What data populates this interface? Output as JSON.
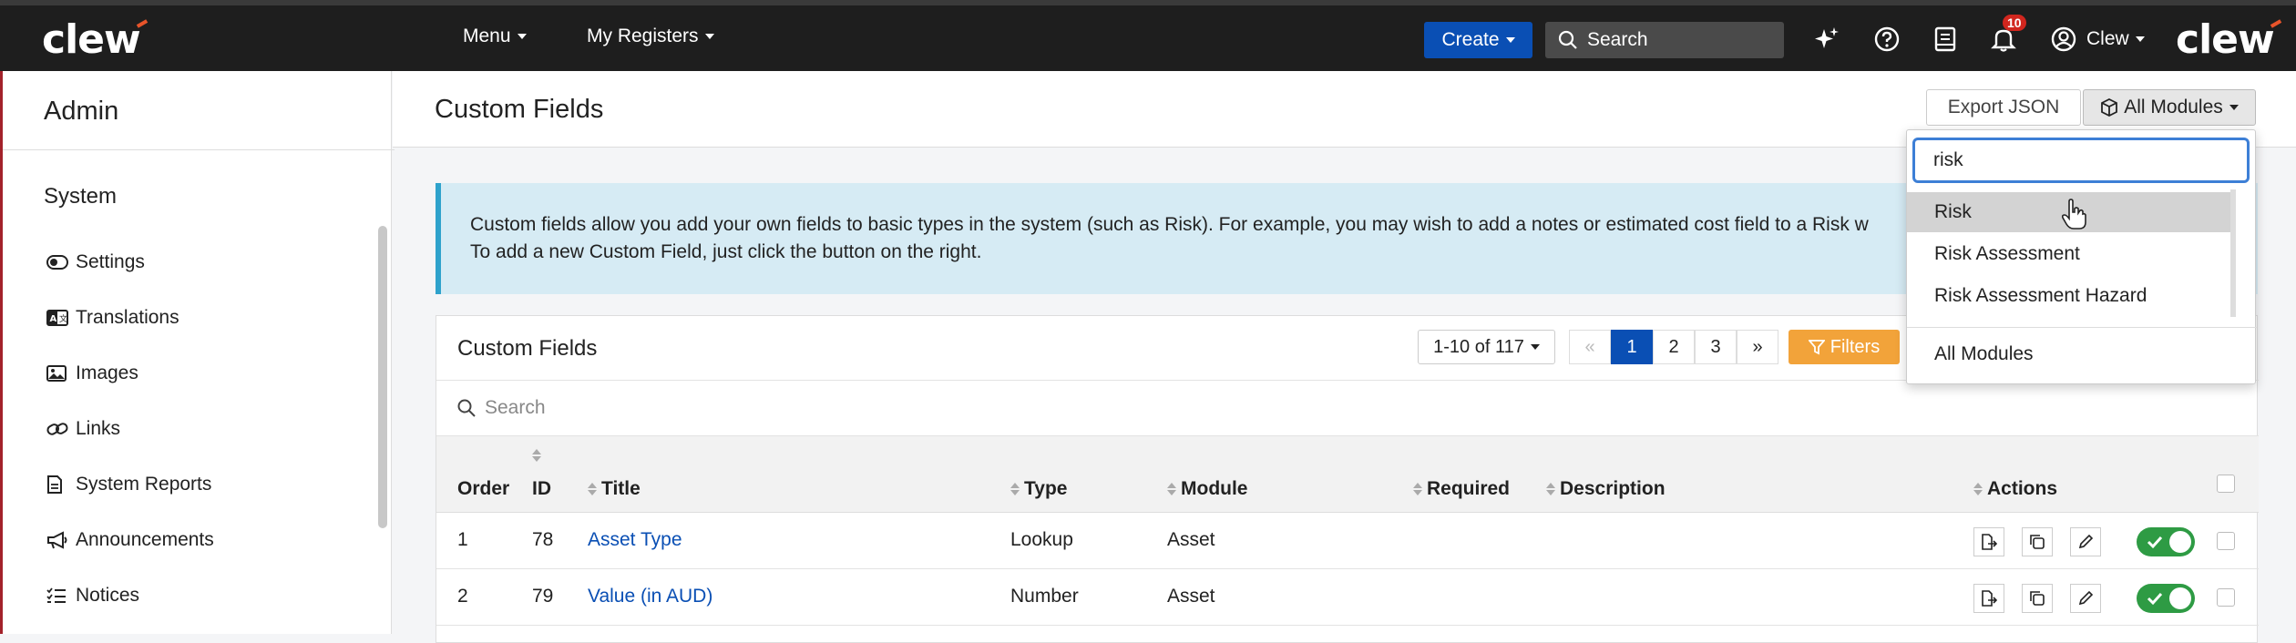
{
  "topbar": {
    "logo_left": "clew",
    "logo_right": "clew",
    "menu_label": "Menu",
    "registers_label": "My Registers",
    "create_label": "Create",
    "search_placeholder": "Search",
    "notification_count": "10",
    "user_label": "Clew"
  },
  "sidebar": {
    "title": "Admin",
    "section": "System",
    "items": [
      {
        "label": "Settings",
        "icon": "toggle-icon"
      },
      {
        "label": "Translations",
        "icon": "translate-icon"
      },
      {
        "label": "Images",
        "icon": "image-icon"
      },
      {
        "label": "Links",
        "icon": "link-icon"
      },
      {
        "label": "System Reports",
        "icon": "report-icon"
      },
      {
        "label": "Announcements",
        "icon": "megaphone-icon"
      },
      {
        "label": "Notices",
        "icon": "list-icon"
      }
    ]
  },
  "page": {
    "title": "Custom Fields",
    "export_label": "Export JSON",
    "modules_label": "All Modules",
    "info_line1": "Custom fields allow you add your own fields to basic types in the system (such as Risk). For example, you may wish to add a notes or estimated cost field to a Risk w",
    "info_line2": "To add a new Custom Field, just click the button on the right."
  },
  "table": {
    "title": "Custom Fields",
    "range": "1-10 of 117",
    "pages": [
      "1",
      "2",
      "3"
    ],
    "active_page": "1",
    "filters_label": "Filters",
    "search_placeholder": "Search",
    "columns": [
      "Order",
      "ID",
      "Title",
      "Type",
      "Module",
      "Required",
      "Description",
      "Actions"
    ],
    "rows": [
      {
        "order": "1",
        "id": "78",
        "title": "Asset Type",
        "type": "Lookup",
        "module": "Asset",
        "required": "",
        "description": "",
        "enabled": true
      },
      {
        "order": "2",
        "id": "79",
        "title": "Value (in AUD)",
        "type": "Number",
        "module": "Asset",
        "required": "",
        "description": "",
        "enabled": true
      }
    ]
  },
  "dropdown": {
    "search_value": "risk",
    "options": [
      "Risk",
      "Risk Assessment",
      "Risk Assessment Hazard"
    ],
    "hovered": "Risk",
    "footer_option": "All Modules"
  },
  "colors": {
    "topbar": "#1e1e1e",
    "primary": "#0a4fb4",
    "filters": "#f2a33a",
    "toggle_on": "#2e9b44",
    "info_bg": "#d6ebf4",
    "info_border": "#2ea2cc",
    "logo_accent": "#e8542a"
  }
}
